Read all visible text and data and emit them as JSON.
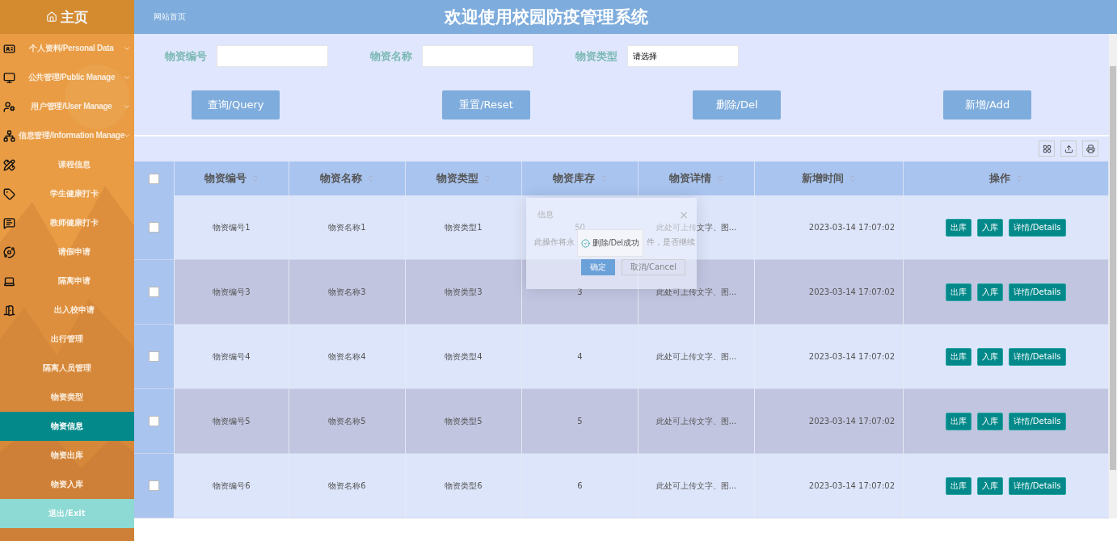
{
  "sidebar": {
    "title": "主页",
    "items": [
      {
        "label": "个人资料/Personal Data",
        "expandable": true,
        "selected": false
      },
      {
        "label": "公共管理/Public Manage",
        "expandable": true,
        "selected": false
      },
      {
        "label": "用户管理/User Manage",
        "expandable": true,
        "selected": false
      },
      {
        "label": "信息管理/Information Manage",
        "expandable": true,
        "selected": false
      },
      {
        "label": "课程信息",
        "expandable": false,
        "selected": false
      },
      {
        "label": "学生健康打卡",
        "expandable": false,
        "selected": false
      },
      {
        "label": "教师健康打卡",
        "expandable": false,
        "selected": false
      },
      {
        "label": "请假申请",
        "expandable": false,
        "selected": false
      },
      {
        "label": "隔离申请",
        "expandable": false,
        "selected": false
      },
      {
        "label": "出入校申请",
        "expandable": false,
        "selected": false
      },
      {
        "label": "出行管理",
        "expandable": false,
        "selected": false
      },
      {
        "label": "隔离人员管理",
        "expandable": false,
        "selected": false
      },
      {
        "label": "物资类型",
        "expandable": false,
        "selected": false
      },
      {
        "label": "物资信息",
        "expandable": false,
        "selected": true
      },
      {
        "label": "物资出库",
        "expandable": false,
        "selected": false
      },
      {
        "label": "物资入库",
        "expandable": false,
        "selected": false
      }
    ],
    "exit": "退出/Exit"
  },
  "header": {
    "breadcrumb": "网站首页",
    "title": "欢迎使用校园防疫管理系统"
  },
  "search": {
    "fields": [
      {
        "label": "物资编号"
      },
      {
        "label": "物资名称"
      },
      {
        "label": "物资类型",
        "value": "请选择"
      }
    ],
    "buttons": [
      "查询/Query",
      "重置/Reset",
      "删除/Del",
      "新增/Add"
    ]
  },
  "table": {
    "all_checked": false,
    "columns": [
      "物资编号",
      "物资名称",
      "物资类型",
      "物资库存",
      "物资详情",
      "新增时间",
      "操作"
    ],
    "rows": [
      {
        "checked": false,
        "cells": [
          "物资编号1",
          "物资名称1",
          "物资类型1",
          "50",
          "此处可上传文字、图...",
          "2023-03-14 17:07:02"
        ],
        "actions": [
          "出库",
          "入库",
          "详情/Details"
        ]
      },
      {
        "checked": false,
        "cells": [
          "物资编号3",
          "物资名称3",
          "物资类型3",
          "3",
          "此处可上传文字、图...",
          "2023-03-14 17:07:02"
        ],
        "actions": [
          "出库",
          "入库",
          "详情/Details"
        ]
      },
      {
        "checked": false,
        "cells": [
          "物资编号4",
          "物资名称4",
          "物资类型4",
          "4",
          "此处可上传文字、图...",
          "2023-03-14 17:07:02"
        ],
        "actions": [
          "出库",
          "入库",
          "详情/Details"
        ]
      },
      {
        "checked": false,
        "cells": [
          "物资编号5",
          "物资名称5",
          "物资类型5",
          "5",
          "此处可上传文字、图...",
          "2023-03-14 17:07:02"
        ],
        "actions": [
          "出库",
          "入库",
          "详情/Details"
        ]
      },
      {
        "checked": false,
        "cells": [
          "物资编号6",
          "物资名称6",
          "物资类型6",
          "6",
          "此处可上传文字、图...",
          "2023-03-14 17:07:02"
        ],
        "actions": [
          "出库",
          "入库",
          "详情/Details"
        ]
      }
    ]
  },
  "dialog": {
    "title": "信息",
    "close": "×",
    "message_parts": [
      "此操作将永",
      "件，是否继续"
    ],
    "buttons": [
      "确定",
      "取消/Cancel"
    ]
  },
  "toast": {
    "message": "删除/Del成功"
  }
}
